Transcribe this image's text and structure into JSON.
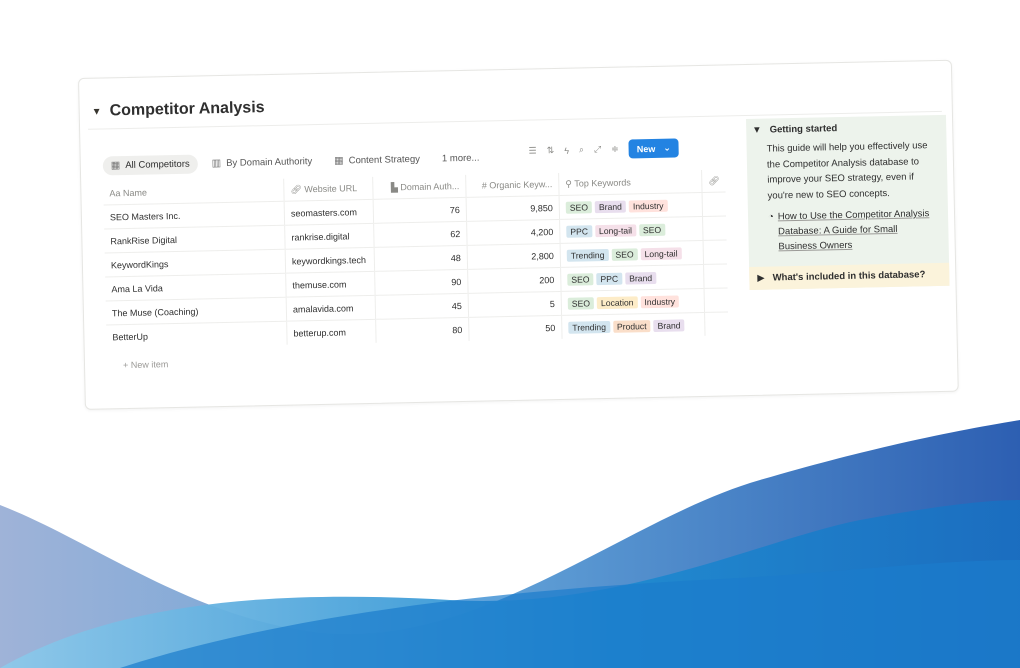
{
  "page": {
    "title": "Competitor Analysis",
    "views": [
      {
        "label": "All Competitors",
        "icon": "table-icon"
      },
      {
        "label": "By Domain Authority",
        "icon": "board-icon"
      },
      {
        "label": "Content Strategy",
        "icon": "table-icon"
      },
      {
        "label": "1 more...",
        "icon": ""
      }
    ],
    "toolbar": {
      "new_label": "New"
    },
    "columns": {
      "name": "Name",
      "url": "Website URL",
      "domain_authority": "Domain Auth...",
      "organic_keywords": "Organic Keyw...",
      "top_keywords": "Top Keywords"
    },
    "rows": [
      {
        "name": "SEO Masters Inc.",
        "url": "seomasters.com",
        "da": "76",
        "ok": "9,850",
        "tags": [
          "SEO",
          "Brand",
          "Industry"
        ]
      },
      {
        "name": "RankRise Digital",
        "url": "rankrise.digital",
        "da": "62",
        "ok": "4,200",
        "tags": [
          "PPC",
          "Long-tail",
          "SEO"
        ]
      },
      {
        "name": "KeywordKings",
        "url": "keywordkings.tech",
        "da": "48",
        "ok": "2,800",
        "tags": [
          "Trending",
          "SEO",
          "Long-tail"
        ]
      },
      {
        "name": "Ama La Vida",
        "url": "themuse.com",
        "da": "90",
        "ok": "200",
        "tags": [
          "SEO",
          "PPC",
          "Brand"
        ]
      },
      {
        "name": "The Muse (Coaching)",
        "url": "amalavida.com",
        "da": "45",
        "ok": "5",
        "tags": [
          "SEO",
          "Location",
          "Industry"
        ]
      },
      {
        "name": "BetterUp",
        "url": "betterup.com",
        "da": "80",
        "ok": "50",
        "tags": [
          "Trending",
          "Product",
          "Brand"
        ]
      }
    ],
    "new_item_label": "New item",
    "tag_colors": {
      "SEO": "#dbeddb",
      "Brand": "#e8deee",
      "Industry": "#ffe2dd",
      "PPC": "#d3e5ef",
      "Long-tail": "#f5e0e9",
      "Trending": "#d3e5ef",
      "Location": "#fdecc8",
      "Product": "#fadec9"
    },
    "sidebar": {
      "heading": "Getting started",
      "body": "This guide will help you effectively use the Competitor Analysis database to improve your SEO strategy, even if you're new to SEO concepts.",
      "link": "How to Use the Competitor Analysis Database: A Guide for Small Business Owners",
      "footer_toggle": "What's included in this database?"
    },
    "colors": {
      "accent": "#2383e2",
      "wave_dark": "#1f6fc4",
      "wave_light": "#5aa6dc"
    }
  }
}
